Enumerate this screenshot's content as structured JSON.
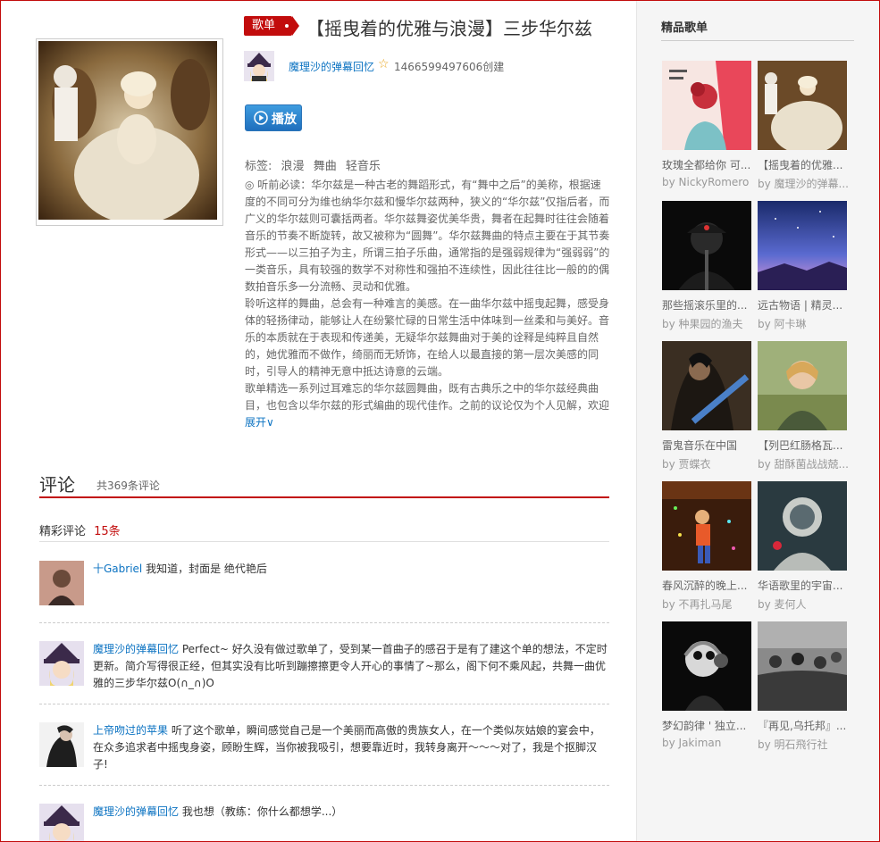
{
  "playlist": {
    "badge": "歌单",
    "title": "【摇曳着的优雅与浪漫】三步华尔兹",
    "creator": "魔理沙的弹幕回忆",
    "created": "1466599497606创建",
    "play_label": "播放",
    "tags_label": "标签:",
    "tags": [
      "浪漫",
      "舞曲",
      "轻音乐"
    ],
    "description": [
      "◎ 听前必读：华尔兹是一种古老的舞蹈形式，有“舞中之后”的美称，根据速度的不同可分为维也纳华尔兹和慢华尔兹两种，狭义的“华尔兹”仅指后者，而广义的华尔兹则可囊括两者。华尔兹舞姿优美华贵，舞者在起舞时往往会随着音乐的节奏不断旋转，故又被称为“圆舞”。华尔兹舞曲的特点主要在于其节奏形式——以三拍子为主，所谓三拍子乐曲，通常指的是强弱规律为“强弱弱”的一类音乐，具有较强的数学不对称性和强拍不连续性，因此往往比一般的的偶数拍音乐多一分流畅、灵动和优雅。",
      "聆听这样的舞曲，总会有一种难言的美感。在一曲华尔兹中摇曳起舞，感受身体的轻扬律动，能够让人在纷繁忙碌的日常生活中体味到一丝柔和与美好。音乐的本质就在于表现和传递美，无疑华尔兹舞曲对于美的诠释是纯粹且自然的，她优雅而不做作，绮丽而无矫饰，在给人以最直接的第一层次美感的同时，引导人的精神无意中抵达诗意的云端。",
      "歌单精选一系列过耳难忘的华尔兹圆舞曲，既有古典乐之中的华尔兹经典曲目，也包含以华尔兹的形式编曲的现代佳作。之前的议论仅为个人见解，欢迎"
    ],
    "expand_label": "展开∨"
  },
  "comments": {
    "title": "评论",
    "total": "共369条评论",
    "hot_label": "精彩评论",
    "hot_count": "15条",
    "items": [
      {
        "user": "十Gabriel",
        "text": " 我知道，封面是 绝代艳后"
      },
      {
        "user": "魔理沙的弹幕回忆",
        "text": " Perfect~ 好久没有做过歌单了，受到某一首曲子的感召于是有了建这个单的想法，不定时更新。简介写得很正经，但其实没有比听到蹦擦擦更令人开心的事情了~那么，阁下何不乘风起，共舞一曲优雅的三步华尔兹O(∩_∩)O"
      },
      {
        "user": "上帝吻过的苹果",
        "text": " 听了这个歌单，瞬间感觉自己是一个美丽而高傲的贵族女人，在一个类似灰姑娘的宴会中，在众多追求者中摇曳身姿，顾盼生辉，当你被我吸引，想要靠近时，我转身离开～～～对了，我是个抠脚汉子!"
      },
      {
        "user": "魔理沙的弹幕回忆",
        "text": " 我也想（教练：你什么都想学...）"
      }
    ]
  },
  "sidebar": {
    "title": "精品歌单",
    "playlists": [
      {
        "name": "玫瑰全都给你 可...",
        "by": "by NickyRomero"
      },
      {
        "name": "【摇曳着的优雅...",
        "by": "by 魔理沙的弹幕..."
      },
      {
        "name": "那些摇滚乐里的...",
        "by": "by 种果园的渔夫"
      },
      {
        "name": "远古物语 | 精灵...",
        "by": "by 阿卡琳"
      },
      {
        "name": "雷鬼音乐在中国",
        "by": "by 贾蝶衣"
      },
      {
        "name": "【列巴红肠格瓦...",
        "by": "by 甜酥菌战战兢..."
      },
      {
        "name": "春风沉醉的晚上...",
        "by": "by 不再扎马尾"
      },
      {
        "name": "华语歌里的宇宙...",
        "by": "by 麦何人"
      },
      {
        "name": "梦幻韵律 ' 独立...",
        "by": "by Jakiman"
      },
      {
        "name": "『再见,乌托邦』...",
        "by": "by 明石飛行社"
      }
    ]
  },
  "colors": {
    "accent": "#c20c0c",
    "link": "#0c73c2",
    "sidebar_bg": "#f5f5f5"
  }
}
